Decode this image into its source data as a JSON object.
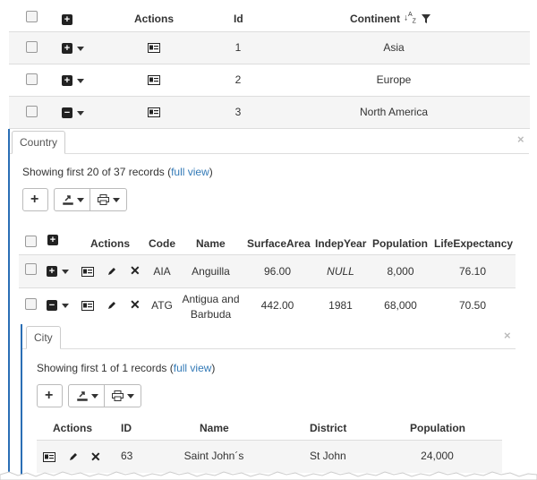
{
  "main_table": {
    "headers": {
      "actions": "Actions",
      "id": "Id",
      "continent": "Continent"
    },
    "rows": [
      {
        "id": "1",
        "continent": "Asia",
        "expanded": false
      },
      {
        "id": "2",
        "continent": "Europe",
        "expanded": false
      },
      {
        "id": "3",
        "continent": "North America",
        "expanded": true
      }
    ]
  },
  "country_panel": {
    "tab": "Country",
    "showing_prefix": "Showing first 20 of 37 records (",
    "full_view": "full view",
    "showing_suffix": ")",
    "headers": {
      "actions": "Actions",
      "code": "Code",
      "name": "Name",
      "surface": "SurfaceArea",
      "indep": "IndepYear",
      "population": "Population",
      "life": "LifeExpectancy"
    },
    "rows": [
      {
        "code": "AIA",
        "name": "Anguilla",
        "surface": "96.00",
        "indep": "NULL",
        "population": "8,000",
        "life": "76.10"
      },
      {
        "code": "ATG",
        "name_line1": "Antigua and",
        "name_line2": "Barbuda",
        "surface": "442.00",
        "indep": "1981",
        "population": "68,000",
        "life": "70.50"
      }
    ]
  },
  "city_panel": {
    "tab": "City",
    "showing_prefix": "Showing first 1 of 1 records (",
    "full_view": "full view",
    "showing_suffix": ")",
    "headers": {
      "actions": "Actions",
      "id": "ID",
      "name": "Name",
      "district": "District",
      "population": "Population"
    },
    "rows": [
      {
        "id": "63",
        "name": "Saint John´s",
        "district": "St John",
        "population": "24,000"
      }
    ]
  },
  "close_glyph": "×",
  "colors": {
    "link": "#337ab7",
    "panel_border": "#2a6eb5",
    "header_bg": "#f5f5f5"
  }
}
